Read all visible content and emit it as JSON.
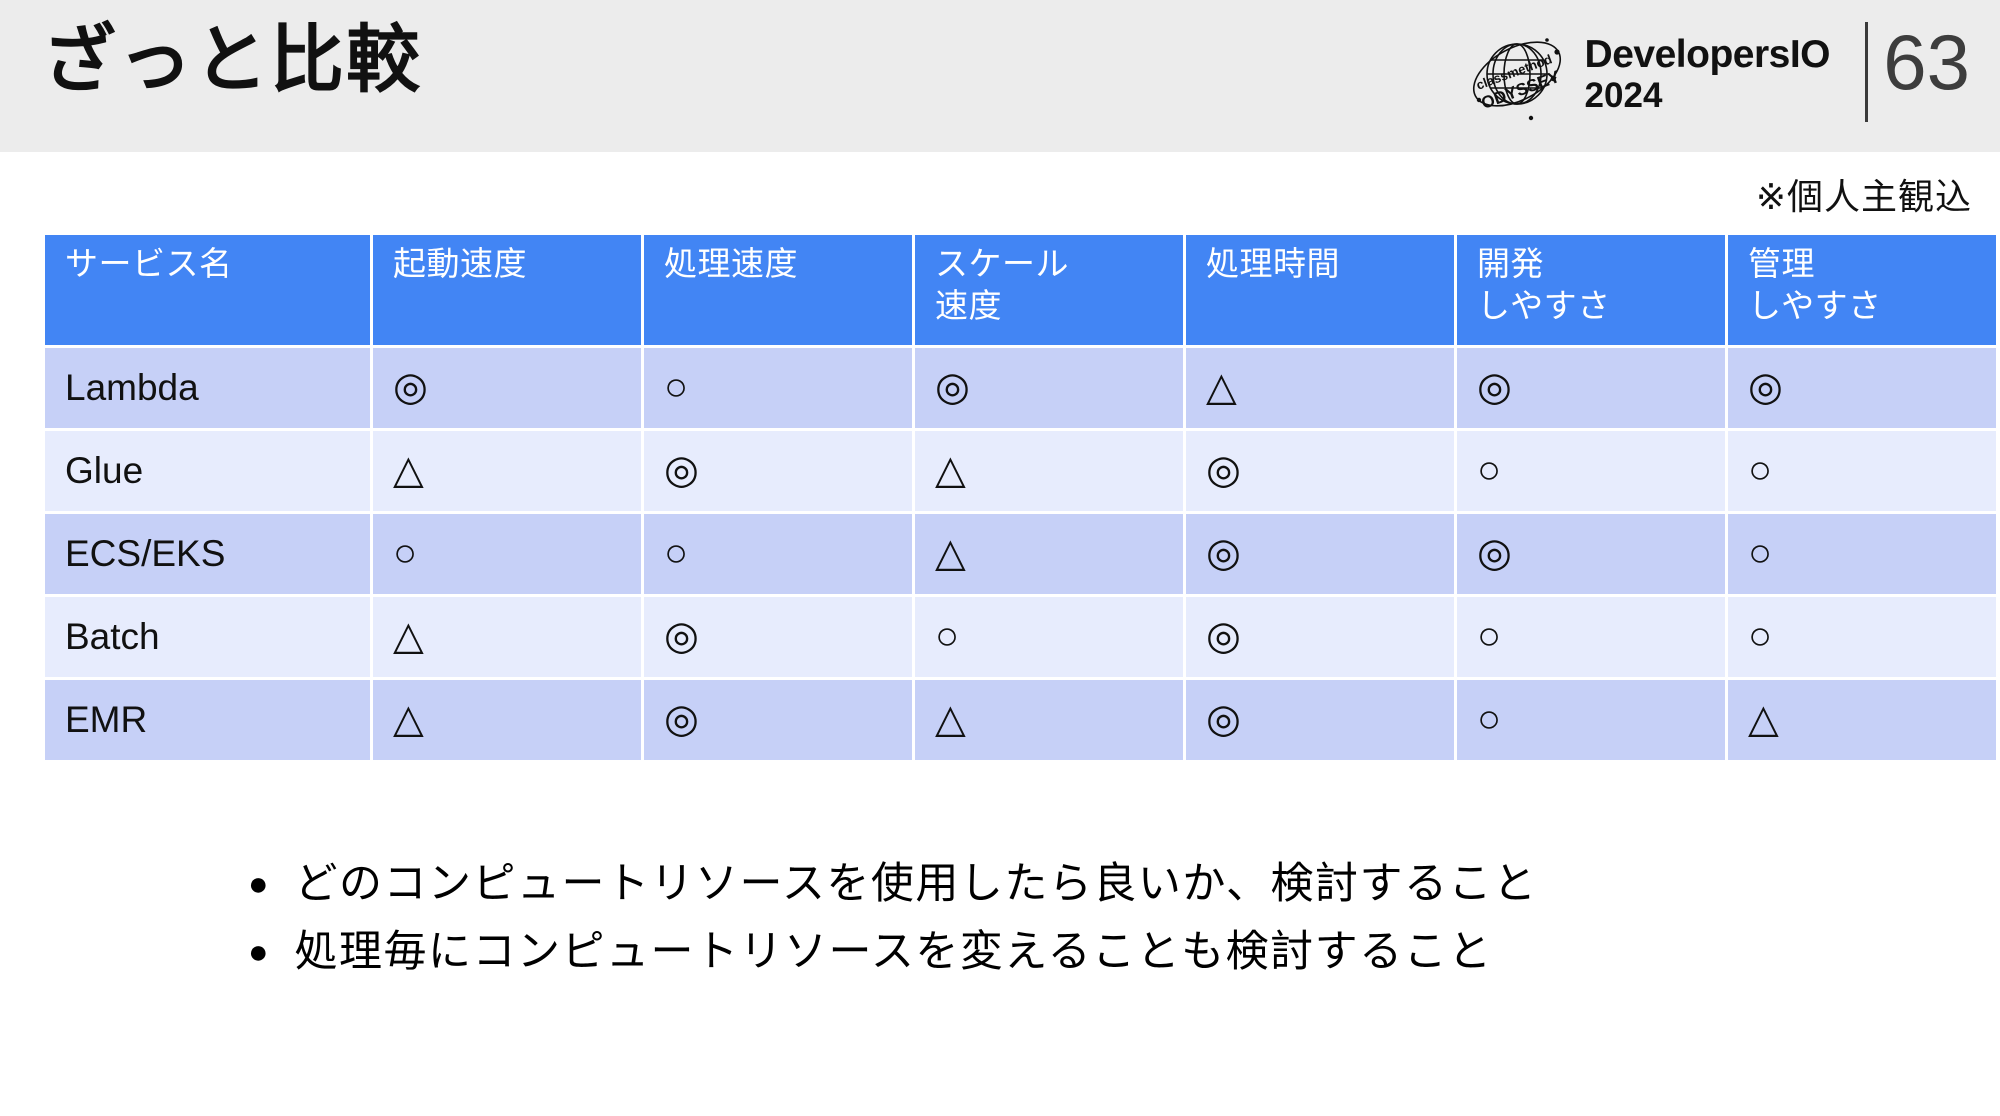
{
  "header": {
    "title": "ざっと比較",
    "brand_line1": "DevelopersIO",
    "brand_line2": "2024",
    "logo_text_top": "classmethod",
    "logo_text_bottom": "ODYSSEY",
    "page_number": "63"
  },
  "note": "※個人主観込",
  "table": {
    "columns": [
      "サービス名",
      "起動速度",
      "処理速度",
      "スケール\n速度",
      "処理時間",
      "開発\nしやすさ",
      "管理\nしやすさ"
    ],
    "columns_display": {
      "c0": "サービス名",
      "c1": "起動速度",
      "c2": "処理速度",
      "c3_line1": "スケール",
      "c3_line2": "速度",
      "c4": "処理時間",
      "c5_line1": "開発",
      "c5_line2": "しやすさ",
      "c6_line1": "管理",
      "c6_line2": "しやすさ"
    },
    "rows": [
      {
        "name": "Lambda",
        "startup": "◎",
        "processing": "○",
        "scale": "◎",
        "duration": "△",
        "dev": "◎",
        "ops": "◎"
      },
      {
        "name": "Glue",
        "startup": "△",
        "processing": "◎",
        "scale": "△",
        "duration": "◎",
        "dev": "○",
        "ops": "○"
      },
      {
        "name": "ECS/EKS",
        "startup": "○",
        "processing": "○",
        "scale": "△",
        "duration": "◎",
        "dev": "◎",
        "ops": "○"
      },
      {
        "name": "Batch",
        "startup": "△",
        "processing": "◎",
        "scale": "○",
        "duration": "◎",
        "dev": "○",
        "ops": "○"
      },
      {
        "name": "EMR",
        "startup": "△",
        "processing": "◎",
        "scale": "△",
        "duration": "◎",
        "dev": "○",
        "ops": "△"
      }
    ]
  },
  "bullets": [
    {
      "marker": "●",
      "text": "どのコンピュートリソースを使用したら良いか、検討すること"
    },
    {
      "marker": "●",
      "text": "処理毎にコンピュートリソースを変えることも検討すること"
    }
  ],
  "colors": {
    "header_bar_bg": "#ececec",
    "table_header_bg": "#4285f4",
    "row_odd_bg": "#c6d0f7",
    "row_even_bg": "#e7ecfd",
    "text": "#111111",
    "page_number": "#3d3d3d"
  }
}
